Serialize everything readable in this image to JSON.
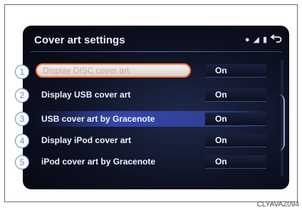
{
  "screen": {
    "title": "Cover art settings",
    "back_icon": "back-arrow-icon"
  },
  "rows": [
    {
      "number": "1",
      "label": "Display DISC cover art",
      "value": "On"
    },
    {
      "number": "2",
      "label": "Display USB cover art",
      "value": "On"
    },
    {
      "number": "3",
      "label": "USB cover art by Gracenote",
      "value": "On"
    },
    {
      "number": "4",
      "label": "Display iPod cover art",
      "value": "On"
    },
    {
      "number": "5",
      "label": "iPod cover art by Gracenote",
      "value": "On"
    }
  ],
  "caption": "CLYAVAZ094",
  "colors": {
    "screen_bg": "#0d1122",
    "selection_border": "#ff7a3a",
    "row_highlight": "#3c50c8",
    "callout_blue": "#6a8ac8"
  }
}
